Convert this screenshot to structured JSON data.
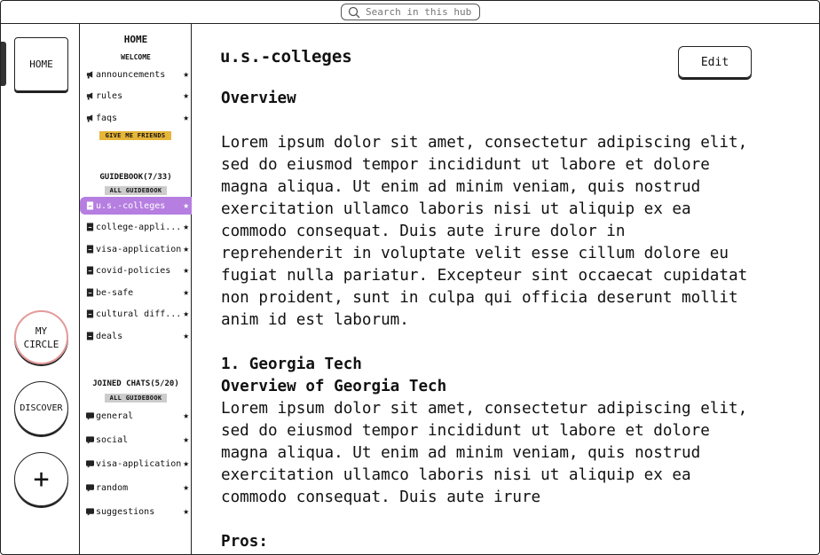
{
  "search": {
    "placeholder": "Search in this hub"
  },
  "rail": {
    "home_label": "HOME",
    "my_circle": "MY CIRCLE",
    "discover": "DISCOVER",
    "add": "+"
  },
  "sidebar": {
    "title": "HOME",
    "welcome_heading": "WELCOME",
    "welcome_items": [
      {
        "label": "announcements",
        "icon": "megaphone-icon"
      },
      {
        "label": "rules",
        "icon": "megaphone-icon"
      },
      {
        "label": "faqs",
        "icon": "megaphone-icon"
      }
    ],
    "give_me_friends": "GIVE ME FRIENDS",
    "guidebook_heading": "GUIDEBOOK(7/33)",
    "all_guidebook": "ALL GUIDEBOOK",
    "guide_items": [
      {
        "label": "u.s.-colleges",
        "active": true
      },
      {
        "label": "college-appli...",
        "active": false
      },
      {
        "label": "visa-application",
        "active": false
      },
      {
        "label": "covid-policies",
        "active": false
      },
      {
        "label": "be-safe",
        "active": false
      },
      {
        "label": "cultural diff...",
        "active": false
      },
      {
        "label": "deals",
        "active": false
      }
    ],
    "chats_heading": "JOINED CHATS(5/20)",
    "all_guidebook_2": "ALL GUIDEBOOK",
    "chat_items": [
      {
        "label": "general"
      },
      {
        "label": "social"
      },
      {
        "label": "visa-application"
      },
      {
        "label": "random"
      },
      {
        "label": "suggestions"
      }
    ]
  },
  "main": {
    "title": "u.s.-colleges",
    "edit_label": "Edit",
    "overview_heading": "Overview",
    "overview_body": "Lorem ipsum dolor sit amet, consectetur adipiscing elit, sed do eiusmod tempor incididunt ut labore et dolore magna aliqua. Ut enim ad minim veniam, quis nostrud exercitation ullamco laboris nisi ut aliquip ex ea commodo consequat. Duis aute irure dolor in reprehenderit in voluptate velit esse cillum dolore eu fugiat nulla pariatur. Excepteur sint occaecat cupidatat non proident, sunt in culpa qui officia deserunt mollit anim id est laborum.",
    "section1_heading": "1. Georgia Tech",
    "section1_sub": "Overview of Georgia Tech",
    "section1_body": "Lorem ipsum dolor sit amet, consectetur adipiscing elit, sed do eiusmod tempor incididunt ut labore et dolore magna aliqua. Ut enim ad minim veniam, quis nostrud exercitation ullamco laboris nisi ut aliquip ex ea commodo consequat. Duis aute irure",
    "pros_heading": "Pros:"
  },
  "colors": {
    "active_item": "#b57ee0",
    "give_me_friends_tag": "#e6b53a",
    "my_circle_ring": "#e39a9a"
  }
}
